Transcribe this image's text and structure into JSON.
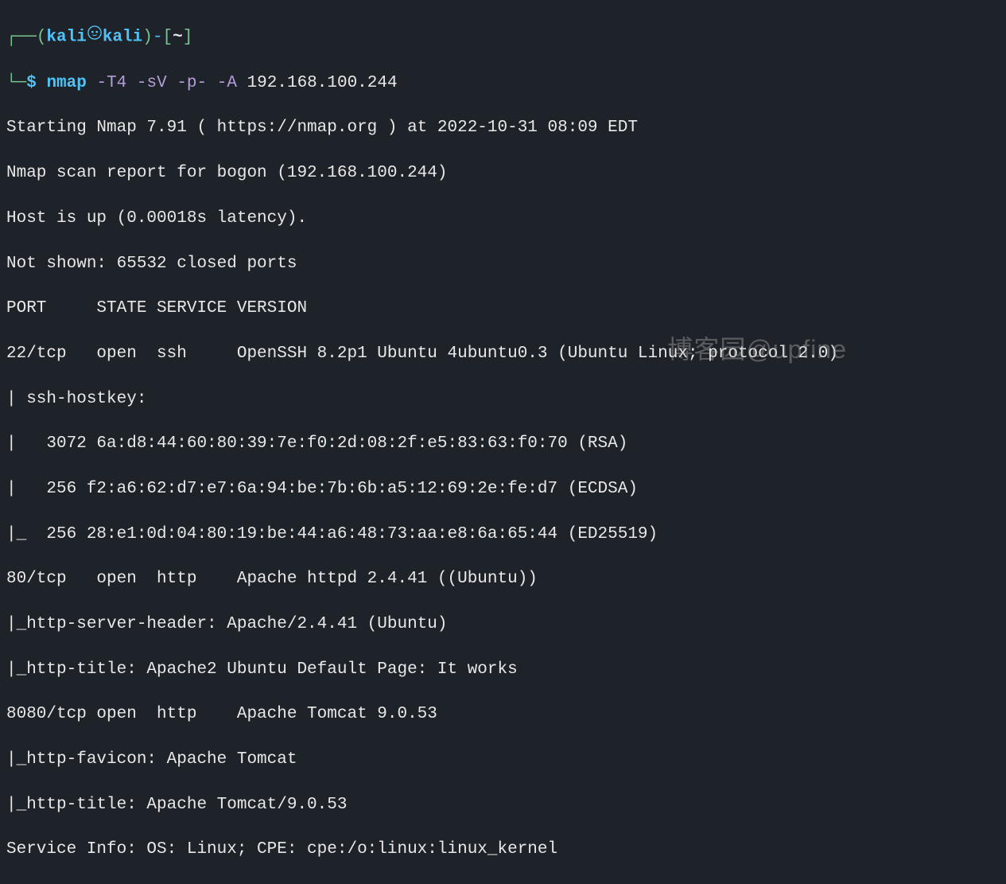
{
  "prompt": {
    "branch_left": "┌──",
    "paren_open": "(",
    "user": "kali",
    "at_glyph": "㉿",
    "host": "kali",
    "paren_close": ")",
    "dash": "-",
    "bracket_open": "[",
    "cwd": "~",
    "bracket_close": "]",
    "branch_bottom": "└─",
    "dollar": "$"
  },
  "command": {
    "name": "nmap",
    "flag1": "-T4",
    "flag2": "-sV",
    "flag3": "-p-",
    "flag4": "-A",
    "target": "192.168.100.244"
  },
  "output": {
    "line1": "Starting Nmap 7.91 ( https://nmap.org ) at 2022-10-31 08:09 EDT",
    "line2": "Nmap scan report for bogon (192.168.100.244)",
    "line3": "Host is up (0.00018s latency).",
    "line4": "Not shown: 65532 closed ports",
    "line5": "PORT     STATE SERVICE VERSION",
    "line6": "22/tcp   open  ssh     OpenSSH 8.2p1 Ubuntu 4ubuntu0.3 (Ubuntu Linux; protocol 2.0)",
    "line7": "| ssh-hostkey: ",
    "line8": "|   3072 6a:d8:44:60:80:39:7e:f0:2d:08:2f:e5:83:63:f0:70 (RSA)",
    "line9": "|   256 f2:a6:62:d7:e7:6a:94:be:7b:6b:a5:12:69:2e:fe:d7 (ECDSA)",
    "line10": "|_  256 28:e1:0d:04:80:19:be:44:a6:48:73:aa:e8:6a:65:44 (ED25519)",
    "line11": "80/tcp   open  http    Apache httpd 2.4.41 ((Ubuntu))",
    "line12": "|_http-server-header: Apache/2.4.41 (Ubuntu)",
    "line13": "|_http-title: Apache2 Ubuntu Default Page: It works",
    "line14": "8080/tcp open  http    Apache Tomcat 9.0.53",
    "line15": "|_http-favicon: Apache Tomcat",
    "line16": "|_http-title: Apache Tomcat/9.0.53",
    "line17": "Service Info: OS: Linux; CPE: cpe:/o:linux:linux_kernel"
  },
  "watermark": "博客园@upfine"
}
